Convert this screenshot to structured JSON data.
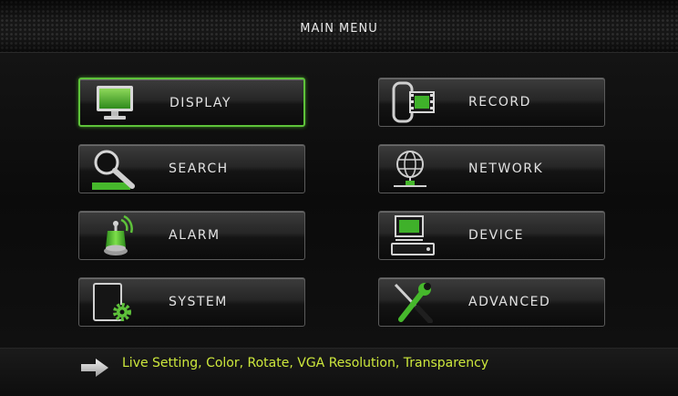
{
  "header": {
    "title": "MAIN MENU"
  },
  "menu": {
    "display": {
      "label": "DISPLAY",
      "icon": "monitor-icon"
    },
    "record": {
      "label": "RECORD",
      "icon": "film-record-icon"
    },
    "search": {
      "label": "SEARCH",
      "icon": "magnifier-icon"
    },
    "network": {
      "label": "NETWORK",
      "icon": "globe-network-icon"
    },
    "alarm": {
      "label": "ALARM",
      "icon": "alarm-beacon-icon"
    },
    "device": {
      "label": "DEVICE",
      "icon": "dvr-device-icon"
    },
    "system": {
      "label": "SYSTEM",
      "icon": "system-gear-icon"
    },
    "advanced": {
      "label": "ADVANCED",
      "icon": "wrench-screwdriver-icon"
    }
  },
  "selected": "display",
  "footer": {
    "hint": "Live Setting, Color, Rotate, VGA Resolution, Transparency"
  },
  "colors": {
    "accent": "#5ec23a",
    "hint_text": "#cde83c",
    "label_text": "#e2e2e2"
  }
}
